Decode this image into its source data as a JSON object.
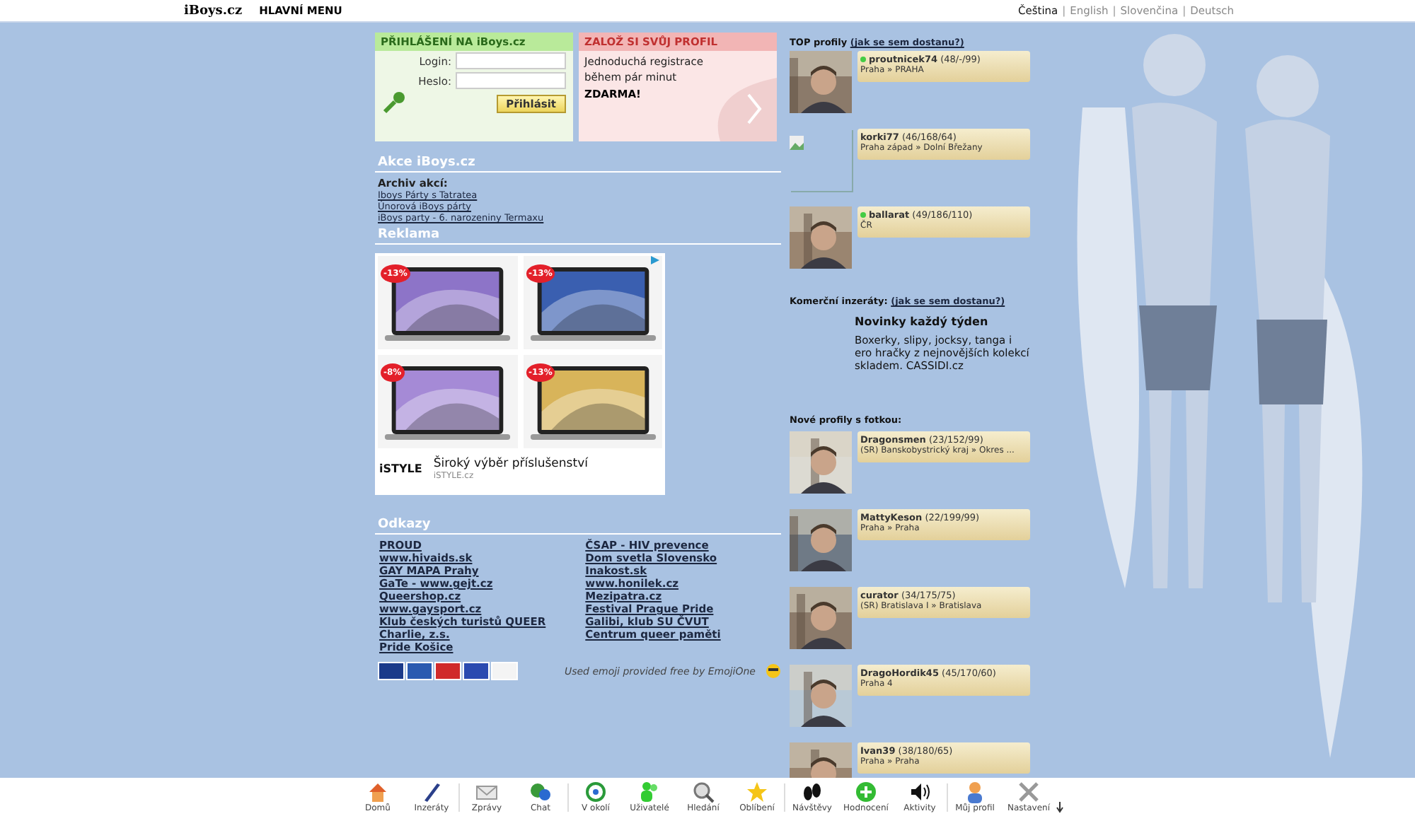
{
  "top_bar": {
    "logo": "iBoys.cz",
    "main_menu": "HLAVNÍ MENU",
    "separator": "|",
    "languages": [
      {
        "label": "Čeština",
        "selected": true
      },
      {
        "label": "English",
        "selected": false
      },
      {
        "label": "Slovenčina",
        "selected": false
      },
      {
        "label": "Deutsch",
        "selected": false
      }
    ]
  },
  "login": {
    "title": "PŘIHLÁŠENÍ NA iBoys.cz",
    "login_label": "Login:",
    "password_label": "Heslo:",
    "button": "Přihlásit"
  },
  "register": {
    "title": "ZALOŽ SI SVŮJ PROFIL",
    "text": "Jednoduchá registrace během pár minut",
    "emphasis": "ZDARMA!"
  },
  "events": {
    "heading": "Akce iBoys.cz",
    "archive_label": "Archiv akcí:",
    "links": [
      "Iboys Párty s Tatratea",
      "Únorová iBoys párty",
      "iBoys party - 6. narozeniny Termaxu"
    ]
  },
  "ad": {
    "heading": "Reklama",
    "products": [
      {
        "discount": "-13%"
      },
      {
        "discount": "-13%"
      },
      {
        "discount": "-8%"
      },
      {
        "discount": "-13%"
      }
    ],
    "logo": "iSTYLE",
    "title": "Široký výběr příslušenství",
    "domain": "iSTYLE.cz"
  },
  "links": {
    "heading": "Odkazy",
    "column_1": [
      "PROUD",
      "www.hivaids.sk",
      "GAY MAPA Prahy",
      "GaTe - www.gejt.cz",
      "Queershop.cz",
      "www.gaysport.cz",
      "Klub českých turistů QUEER",
      "Charlie, z.s.",
      "Pride Košice"
    ],
    "column_2": [
      "ČSAP - HIV prevence",
      "Dom svetla Slovensko",
      "Inakost.sk",
      "www.honilek.cz",
      "Mezipatra.cz",
      "Festival Prague Pride",
      "Galibi, klub SU ČVUT",
      "Centrum queer paměti"
    ]
  },
  "emoji_credit": "Used emoji provided free by EmojiOne",
  "top_profiles": {
    "heading": "TOP profily",
    "link": "(jak se sem dostanu?)",
    "items": [
      {
        "name": "proutnicek74",
        "stats": "(48/-/99)",
        "place": "Praha » PRAHA",
        "online": true,
        "kind": "picture"
      },
      {
        "name": "korki77",
        "stats": "(46/168/64)",
        "place": "Praha západ » Dolní Břežany",
        "online": false,
        "kind": "broken"
      },
      {
        "name": "ballarat",
        "stats": "(49/186/110)",
        "place": "ČR",
        "online": true,
        "kind": "picture"
      }
    ]
  },
  "commercial": {
    "heading": "Komerční inzeráty:",
    "link": "(jak se sem dostanu?)",
    "title": "Novinky každý týden",
    "text": "Boxerky, slipy, jocksy, tanga i ero hračky z nejnovějších kolekcí skladem. CASSIDI.cz"
  },
  "new_profiles": {
    "heading": "Nové profily s fotkou:",
    "items": [
      {
        "name": "Dragonsmen",
        "stats": "(23/152/99)",
        "place": "(SR) Banskobystrický kraj » Okres ..."
      },
      {
        "name": "MattyKeson",
        "stats": "(22/199/99)",
        "place": "Praha » Praha"
      },
      {
        "name": "curator",
        "stats": "(34/175/75)",
        "place": "(SR) Bratislava I » Bratislava"
      },
      {
        "name": "DragoHordik45",
        "stats": "(45/170/60)",
        "place": "Praha 4"
      },
      {
        "name": "Ivan39",
        "stats": "(38/180/65)",
        "place": "Praha » Praha"
      }
    ]
  },
  "toolbar": [
    {
      "label": "Domů"
    },
    {
      "label": "Inzeráty"
    },
    {
      "label": "Zprávy"
    },
    {
      "label": "Chat"
    },
    {
      "label": "V okolí"
    },
    {
      "label": "Uživatelé"
    },
    {
      "label": "Hledání"
    },
    {
      "label": "Oblíbení"
    },
    {
      "label": "Návštěvy"
    },
    {
      "label": "Hodnocení"
    },
    {
      "label": "Aktivity"
    },
    {
      "label": "Můj profil"
    },
    {
      "label": "Nastavení"
    }
  ]
}
